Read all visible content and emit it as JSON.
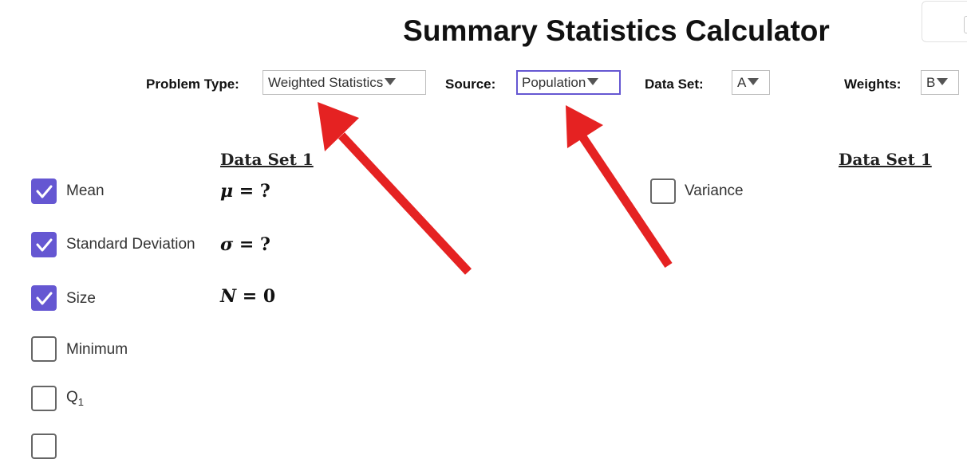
{
  "title": "Summary Statistics Calculator",
  "controls": {
    "problem_type": {
      "label": "Problem Type:",
      "value": "Weighted Statistics"
    },
    "source": {
      "label": "Source:",
      "value": "Population"
    },
    "data_set": {
      "label": "Data Set:",
      "value": "A"
    },
    "weights": {
      "label": "Weights:",
      "value": "B"
    }
  },
  "left_panel": {
    "header": "Data Set 1",
    "items": [
      {
        "label": "Mean",
        "checked": true,
        "symbol": "μ",
        "value": "?"
      },
      {
        "label": "Standard Deviation",
        "checked": true,
        "symbol": "σ",
        "value": "?"
      },
      {
        "label": "Size",
        "checked": true,
        "symbol": "N",
        "value": "0"
      },
      {
        "label": "Minimum",
        "checked": false
      },
      {
        "label": "Q",
        "sub": "1",
        "checked": false
      }
    ]
  },
  "right_panel": {
    "header": "Data Set 1",
    "items": [
      {
        "label": "Variance",
        "checked": false
      }
    ]
  },
  "colors": {
    "accent": "#6557d2",
    "annotation_arrow": "#e52222"
  },
  "icons": {
    "dropdown": "caret-down-icon",
    "checkbox_checked": "checkmark-icon",
    "annotation": "red-arrow-icon"
  }
}
